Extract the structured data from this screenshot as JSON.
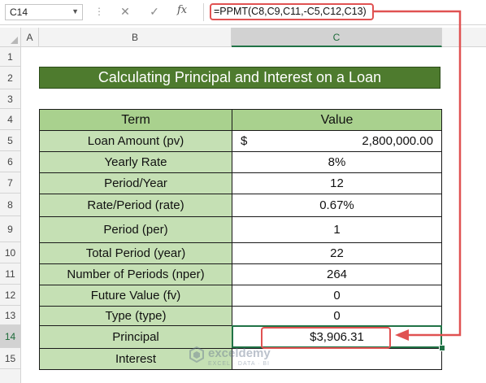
{
  "formula_bar": {
    "name_box": "C14",
    "cancel_icon": "✕",
    "enter_icon": "✓",
    "fx_label": "fx",
    "formula": "=PPMT(C8,C9,C11,-C5,C12,C13)"
  },
  "columns": [
    "A",
    "B",
    "C"
  ],
  "rows": [
    "1",
    "2",
    "3",
    "4",
    "5",
    "6",
    "7",
    "8",
    "9",
    "10",
    "11",
    "12",
    "13",
    "14",
    "15"
  ],
  "selected_cell": "C14",
  "title": "Calculating Principal and Interest on a Loan",
  "table": {
    "header_term": "Term",
    "header_value": "Value",
    "rows": [
      {
        "term": "Loan Amount (pv)",
        "currency": "$",
        "value": "2,800,000.00"
      },
      {
        "term": "Yearly Rate",
        "value": "8%"
      },
      {
        "term": "Period/Year",
        "value": "12"
      },
      {
        "term": "Rate/Period (rate)",
        "value": "0.67%"
      },
      {
        "term": "Period (per)",
        "value": "1"
      },
      {
        "term": "Total Period (year)",
        "value": "22"
      },
      {
        "term": "Number of Periods (nper)",
        "value": "264"
      },
      {
        "term": "Future Value (fv)",
        "value": "0"
      },
      {
        "term": "Type (type)",
        "value": "0"
      },
      {
        "term": "Principal",
        "value": "$3,906.31"
      },
      {
        "term": "Interest",
        "value": ""
      }
    ]
  },
  "watermark": {
    "name": "exceldemy",
    "tagline": "EXCEL · DATA · BI"
  },
  "colors": {
    "title_bg": "#4e7b2e",
    "header_bg": "#a9d18e",
    "label_bg": "#c5e0b4",
    "highlight": "#e05252",
    "selection": "#217346"
  }
}
